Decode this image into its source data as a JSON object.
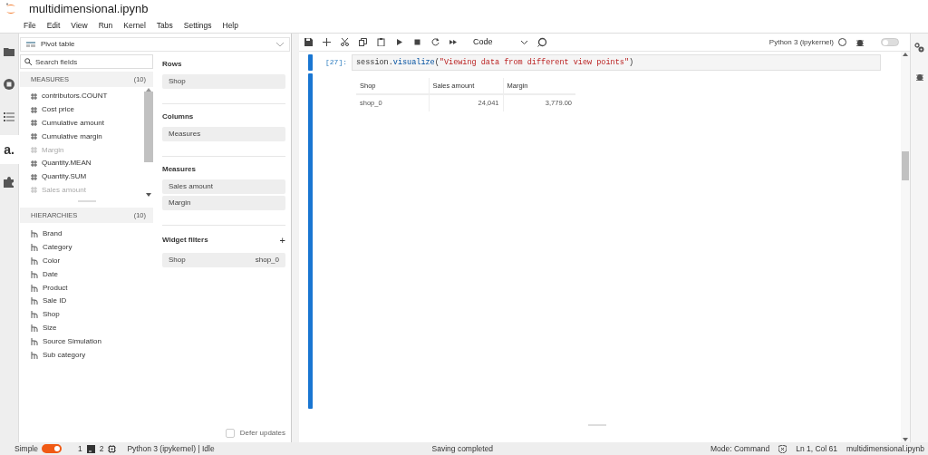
{
  "app": {
    "title": "multidimensional.ipynb"
  },
  "menu": [
    "File",
    "Edit",
    "View",
    "Run",
    "Kernel",
    "Tabs",
    "Settings",
    "Help"
  ],
  "activity_bar": [
    {
      "kind": "folder",
      "selected": false
    },
    {
      "kind": "stop",
      "selected": false
    },
    {
      "kind": "list",
      "selected": false
    },
    {
      "kind": "logo",
      "glyph": "a.",
      "selected": true
    },
    {
      "kind": "puzzle",
      "selected": false
    }
  ],
  "widget": {
    "type": "Pivot table",
    "search": {
      "placeholder": "Search fields"
    },
    "measures": {
      "title": "MEASURES",
      "count": "(10)",
      "items": [
        {
          "label": "contributors.COUNT",
          "in_use": false
        },
        {
          "label": "Cost price",
          "in_use": false
        },
        {
          "label": "Cumulative amount",
          "in_use": false
        },
        {
          "label": "Cumulative margin",
          "in_use": false
        },
        {
          "label": "Margin",
          "in_use": true
        },
        {
          "label": "Quantity.MEAN",
          "in_use": false
        },
        {
          "label": "Quantity.SUM",
          "in_use": false
        },
        {
          "label": "Sales amount",
          "in_use": true
        }
      ]
    },
    "hierarchies": {
      "title": "HIERARCHIES",
      "count": "(10)",
      "items": [
        "Brand",
        "Category",
        "Color",
        "Date",
        "Product",
        "Sale ID",
        "Shop",
        "Size",
        "Source Simulation",
        "Sub category"
      ]
    },
    "sections": [
      {
        "title": "Rows",
        "items": [
          "Shop"
        ]
      },
      {
        "title": "Columns",
        "items": [
          "Measures"
        ]
      },
      {
        "title": "Measures",
        "items": [
          "Sales amount",
          "Margin"
        ]
      }
    ],
    "filters": {
      "title": "Widget filters",
      "add": "+",
      "items": [
        {
          "field": "Shop",
          "value": "shop_0"
        }
      ]
    },
    "defer": {
      "label": "Defer updates",
      "checked": false
    }
  },
  "toolbar": {
    "cell_type": "Code",
    "kernel": "Python 3 (ipykernel)",
    "kernel_busy": false,
    "toggle_on": false
  },
  "cell": {
    "prompt": "[27]:",
    "code": [
      {
        "kind": "plain",
        "text": "session."
      },
      {
        "kind": "function",
        "text": "visualize"
      },
      {
        "kind": "plain",
        "text": "("
      },
      {
        "kind": "string",
        "text": "\"Viewing data from different view points\""
      },
      {
        "kind": "plain",
        "text": ")"
      }
    ],
    "output": {
      "columns": [
        "Shop",
        "Sales amount",
        "Margin"
      ],
      "rows": [
        [
          "shop_0",
          "24,041",
          "3,779.00"
        ]
      ]
    }
  },
  "status": {
    "mode_label": "Simple",
    "simple_on": true,
    "terminals": "1",
    "kernels": "2",
    "kernel_status": "Python 3 (ipykernel) | Idle",
    "message": "Saving completed",
    "mode": "Mode: Command",
    "position": "Ln 1, Col 61",
    "file": "multidimensional.ipynb"
  }
}
